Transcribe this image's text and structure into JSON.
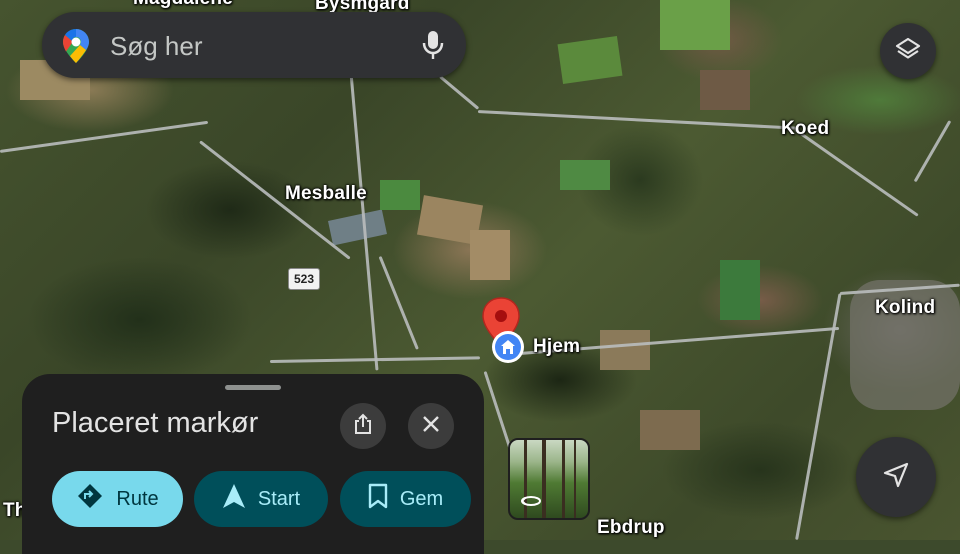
{
  "search": {
    "placeholder": "Søg her",
    "icons": {
      "logo": "google-maps-pin-icon",
      "mic": "microphone-icon"
    }
  },
  "map": {
    "places": {
      "top_partial_left": "Magdalene",
      "top_partial_right": "Bysmgård",
      "koed": "Koed",
      "mesballe": "Mesballe",
      "kolind": "Kolind",
      "hjem": "Hjem",
      "ebdrup": "Ebdrup",
      "left_partial": "Th"
    },
    "road_shield": "523"
  },
  "controls": {
    "layers_icon": "layers-icon",
    "navigate_icon": "navigation-arrow-icon"
  },
  "sheet": {
    "title": "Placeret markør",
    "share_icon": "share-icon",
    "close_icon": "close-icon",
    "buttons": {
      "route": "Rute",
      "start": "Start",
      "save": "Gem"
    }
  },
  "streetview": {
    "icon": "street-view-rotate-icon"
  },
  "colors": {
    "sheet_bg": "#1f1f1f",
    "route_bg": "#78d9ec",
    "secondary_bg": "#004f5a",
    "marker_red": "#ea4335",
    "home_blue": "#4285f4"
  }
}
